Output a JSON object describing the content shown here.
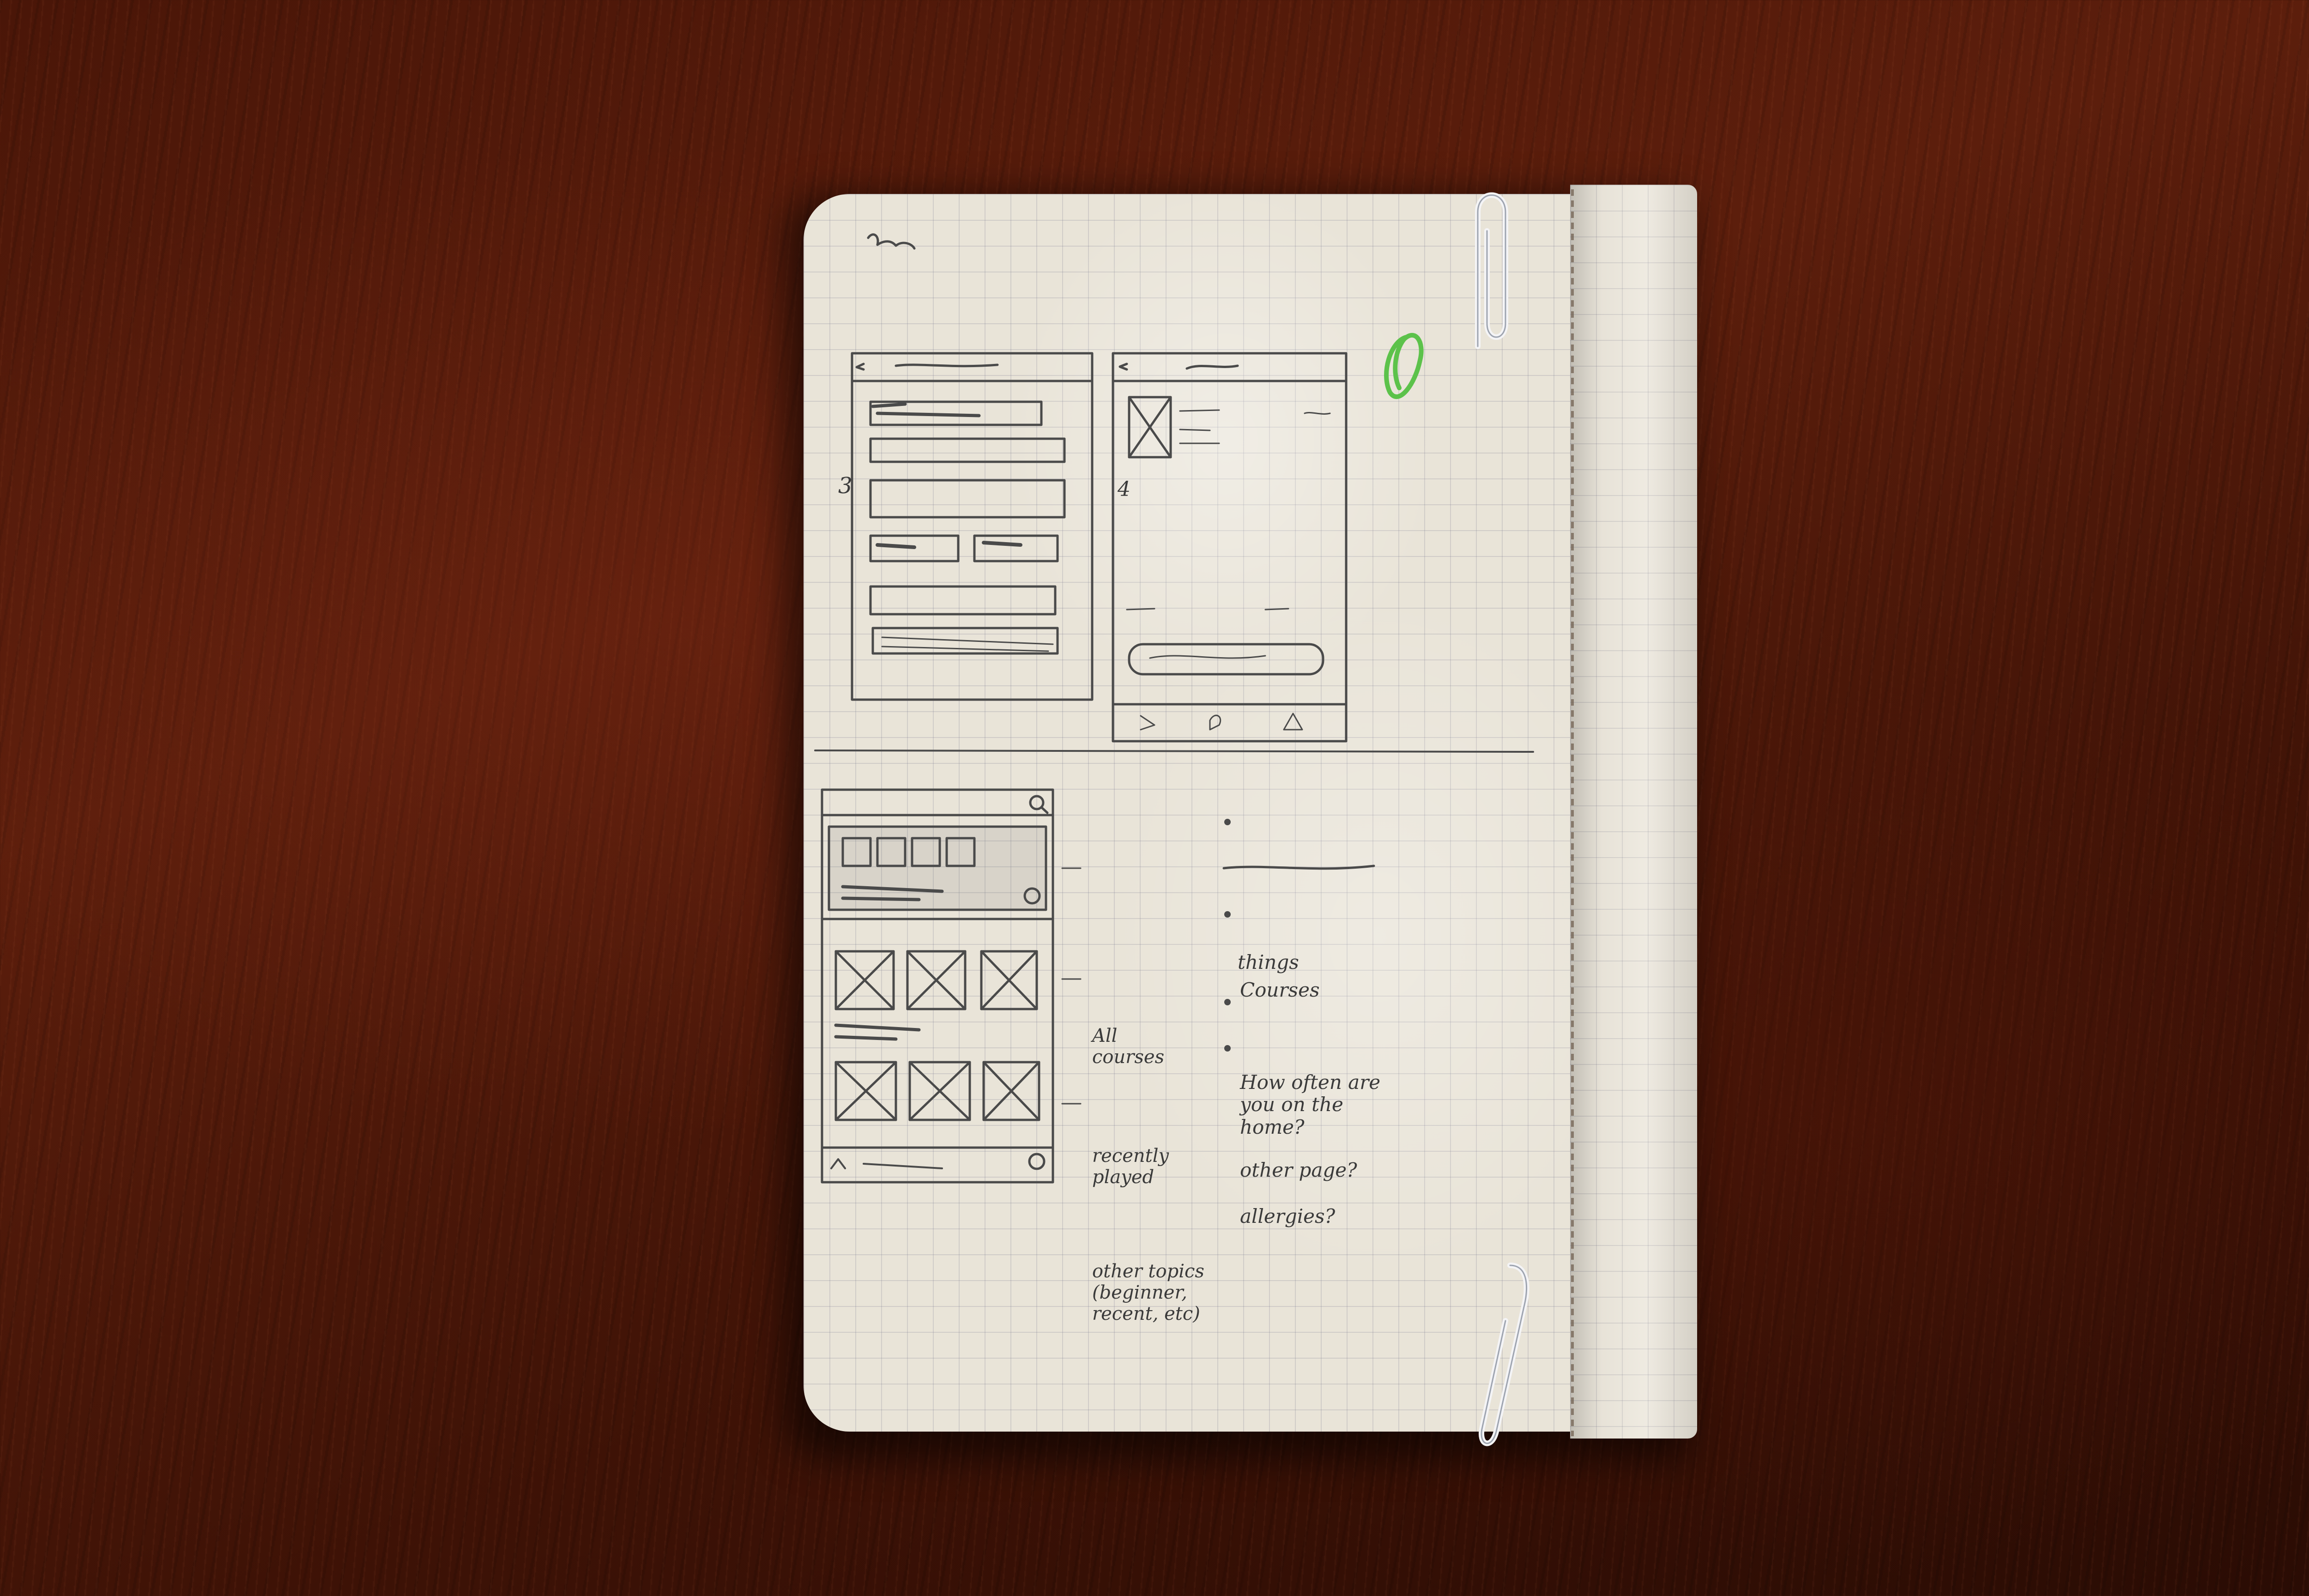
{
  "notebook": {
    "page_numbers": [
      "3",
      "4"
    ],
    "annotations": {
      "all_courses": "All courses",
      "recently_played": "recently played",
      "other_topics": "other topics (beginner, recent, etc)"
    },
    "checklist": {
      "heading": "things",
      "items": [
        "Courses",
        "How often are you on the home?",
        "other page?",
        "allergies?"
      ]
    }
  },
  "colors": {
    "wood": "#4a1608",
    "paper": "#e9e4d8",
    "pencil": "#3a3a3a",
    "check_mark": "#5cc24a"
  }
}
